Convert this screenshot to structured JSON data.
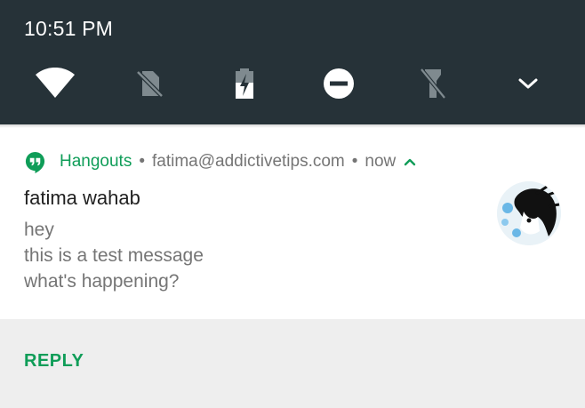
{
  "status_bar": {
    "time": "10:51 PM"
  },
  "quick_settings": {
    "tiles": [
      {
        "icon": "wifi-icon"
      },
      {
        "icon": "no-sim-icon"
      },
      {
        "icon": "battery-charging-icon"
      },
      {
        "icon": "do-not-disturb-icon"
      },
      {
        "icon": "flashlight-off-icon"
      },
      {
        "icon": "expand-chevron-down-icon"
      }
    ],
    "icon_color": "#ffffff",
    "dim_icon_color": "#7f8a8f"
  },
  "notification": {
    "app_name": "Hangouts",
    "separator": "•",
    "account": "fatima@addictivetips.com",
    "time": "now",
    "sender": "fatima wahab",
    "messages": [
      "hey",
      "this is a test message",
      "what's happening?"
    ],
    "accent_color": "#0f9d58"
  },
  "actions": {
    "reply_label": "REPLY"
  }
}
